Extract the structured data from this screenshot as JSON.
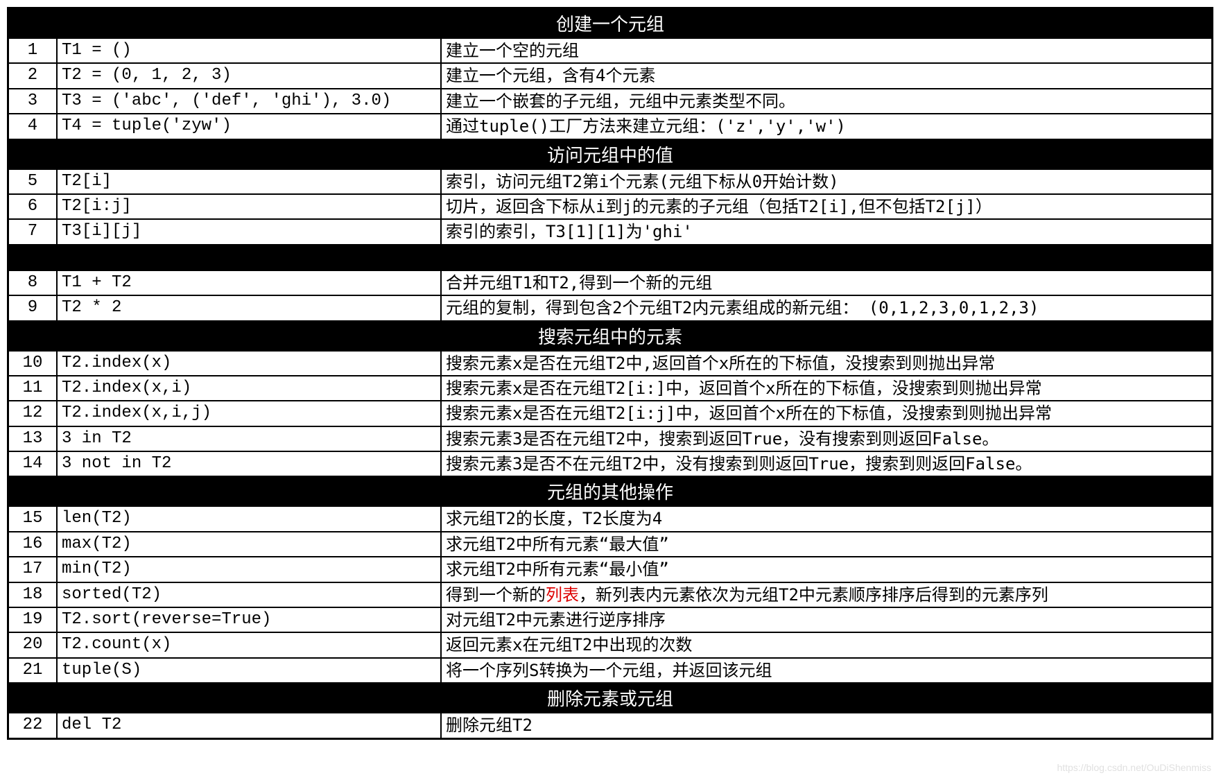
{
  "watermark": "https://blog.csdn.net/OuDiShenmiss",
  "sections": [
    {
      "title": "创建一个元组",
      "rows": [
        {
          "n": "1",
          "code": "T1 = ()",
          "desc": "建立一个空的元组"
        },
        {
          "n": "2",
          "code": "T2 = (0, 1, 2, 3)",
          "desc": "建立一个元组，含有4个元素"
        },
        {
          "n": "3",
          "code": "T3 = ('abc', ('def', 'ghi'), 3.0)",
          "desc": "建立一个嵌套的子元组，元组中元素类型不同。"
        },
        {
          "n": "4",
          "code": "T4 = tuple('zyw')",
          "desc": "通过tuple()工厂方法来建立元组：('z','y','w')"
        }
      ]
    },
    {
      "title": "访问元组中的值",
      "rows": [
        {
          "n": "5",
          "code": "T2[i]",
          "desc": "索引，访问元组T2第i个元素(元组下标从0开始计数)"
        },
        {
          "n": "6",
          "code": "T2[i:j]",
          "desc": "切片，返回含下标从i到j的元素的子元组（包括T2[i],但不包括T2[j]）"
        },
        {
          "n": "7",
          "code": "T3[i][j]",
          "desc": "索引的索引，T3[1][1]为'ghi'"
        }
      ]
    },
    {
      "title": "",
      "rows": [
        {
          "n": "8",
          "code": "T1 + T2",
          "desc": "合并元组T1和T2,得到一个新的元组"
        },
        {
          "n": "9",
          "code": "T2 * 2",
          "desc": "元组的复制，得到包含2个元组T2内元素组成的新元组： (0,1,2,3,0,1,2,3)"
        }
      ]
    },
    {
      "title": "搜索元组中的元素",
      "rows": [
        {
          "n": "10",
          "code": "T2.index(x)",
          "desc": "搜索元素x是否在元组T2中,返回首个x所在的下标值，没搜索到则抛出异常"
        },
        {
          "n": "11",
          "code": "T2.index(x,i)",
          "desc": "搜索元素x是否在元组T2[i:]中，返回首个x所在的下标值，没搜索到则抛出异常"
        },
        {
          "n": "12",
          "code": "T2.index(x,i,j)",
          "desc": "搜索元素x是否在元组T2[i:j]中，返回首个x所在的下标值，没搜索到则抛出异常"
        },
        {
          "n": "13",
          "code": "3 in T2",
          "desc": "搜索元素3是否在元组T2中，搜索到返回True，没有搜索到则返回False。"
        },
        {
          "n": "14",
          "code": "3 not in T2",
          "desc": "搜索元素3是否不在元组T2中，没有搜索到则返回True，搜索到则返回False。"
        }
      ]
    },
    {
      "title": "元组的其他操作",
      "rows": [
        {
          "n": "15",
          "code": "len(T2)",
          "desc": "求元组T2的长度，T2长度为4"
        },
        {
          "n": "16",
          "code": "max(T2)",
          "desc": "求元组T2中所有元素“最大值”"
        },
        {
          "n": "17",
          "code": "min(T2)",
          "desc": "求元组T2中所有元素“最小值”"
        },
        {
          "n": "18",
          "code": "sorted(T2)",
          "desc_pre": "得到一个新的",
          "desc_hl": "列表",
          "desc_post": "，新列表内元素依次为元组T2中元素顺序排序后得到的元素序列"
        },
        {
          "n": "19",
          "code": "T2.sort(reverse=True)",
          "desc": "对元组T2中元素进行逆序排序"
        },
        {
          "n": "20",
          "code": "T2.count(x)",
          "desc": "返回元素x在元组T2中出现的次数"
        },
        {
          "n": "21",
          "code": "tuple(S)",
          "desc": "将一个序列S转换为一个元组，并返回该元组"
        }
      ]
    },
    {
      "title": "删除元素或元组",
      "rows": [
        {
          "n": "22",
          "code": "del T2",
          "desc": "删除元组T2"
        }
      ]
    }
  ]
}
